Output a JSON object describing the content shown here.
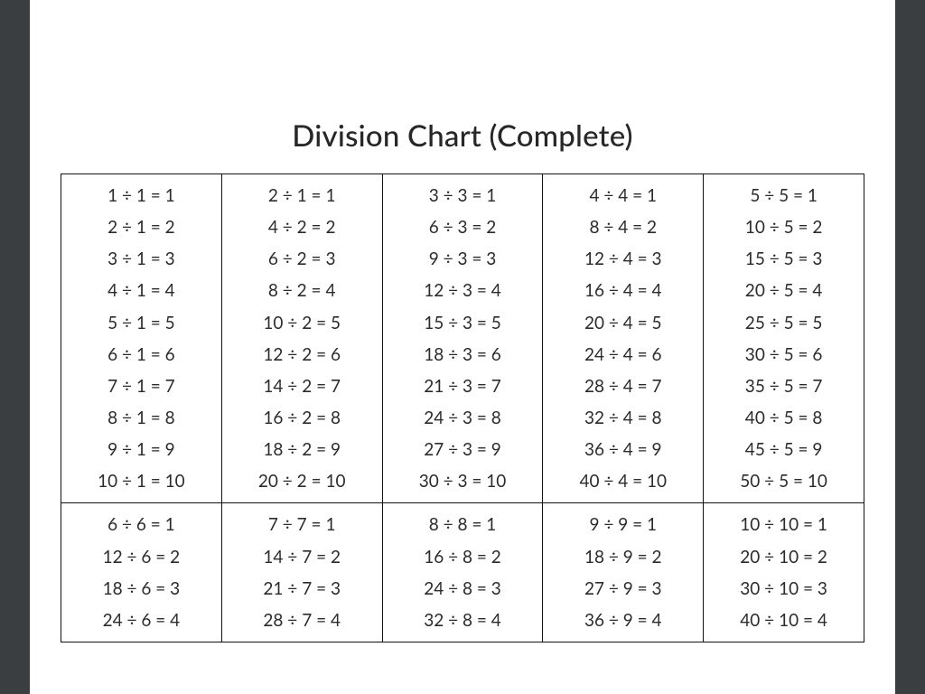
{
  "title": "Division Chart (Complete)",
  "chart_data": {
    "type": "table",
    "title": "Division Chart (Complete)",
    "divisors_row1": [
      1,
      2,
      3,
      4,
      5
    ],
    "divisors_row2": [
      6,
      7,
      8,
      9,
      10
    ],
    "quotients_row1": [
      1,
      2,
      3,
      4,
      5,
      6,
      7,
      8,
      9,
      10
    ],
    "quotients_row2_visible": [
      1,
      2,
      3,
      4
    ],
    "cells": {
      "r0c0": [
        "1 ÷ 1 = 1",
        "2 ÷ 1 = 2",
        "3 ÷ 1 = 3",
        "4 ÷ 1 = 4",
        "5 ÷ 1 = 5",
        "6 ÷ 1 = 6",
        "7 ÷ 1 = 7",
        "8 ÷ 1 = 8",
        "9 ÷ 1 = 9",
        "10 ÷ 1 = 10"
      ],
      "r0c1": [
        "2 ÷ 1 = 1",
        "4 ÷ 2 = 2",
        "6 ÷ 2 = 3",
        "8 ÷ 2 = 4",
        "10 ÷ 2 = 5",
        "12 ÷ 2 = 6",
        "14 ÷ 2 = 7",
        "16 ÷ 2 = 8",
        "18 ÷ 2 = 9",
        "20 ÷ 2 = 10"
      ],
      "r0c2": [
        "3 ÷ 3 = 1",
        "6 ÷ 3 = 2",
        "9 ÷ 3 = 3",
        "12 ÷ 3 = 4",
        "15 ÷ 3 = 5",
        "18 ÷ 3 = 6",
        "21 ÷ 3 = 7",
        "24 ÷ 3 = 8",
        "27 ÷ 3 = 9",
        "30 ÷ 3 = 10"
      ],
      "r0c3": [
        "4 ÷ 4 = 1",
        "8 ÷ 4 = 2",
        "12 ÷ 4 = 3",
        "16 ÷ 4 = 4",
        "20 ÷ 4 = 5",
        "24 ÷ 4 = 6",
        "28 ÷ 4 = 7",
        "32 ÷ 4 = 8",
        "36 ÷ 4 = 9",
        "40 ÷ 4 = 10"
      ],
      "r0c4": [
        "5 ÷ 5 = 1",
        "10 ÷ 5 = 2",
        "15 ÷ 5 = 3",
        "20 ÷ 5 = 4",
        "25 ÷ 5 = 5",
        "30 ÷ 5 = 6",
        "35 ÷ 5 = 7",
        "40 ÷ 5 = 8",
        "45 ÷ 5 = 9",
        "50 ÷ 5 = 10"
      ],
      "r1c0": [
        "6 ÷ 6 = 1",
        "12 ÷ 6 = 2",
        "18 ÷ 6 = 3",
        "24 ÷ 6 = 4"
      ],
      "r1c1": [
        "7 ÷ 7 = 1",
        "14 ÷ 7 = 2",
        "21 ÷ 7 = 3",
        "28 ÷ 7 = 4"
      ],
      "r1c2": [
        "8 ÷ 8 = 1",
        "16 ÷ 8 = 2",
        "24 ÷ 8 = 3",
        "32 ÷ 8 = 4"
      ],
      "r1c3": [
        "9 ÷ 9 = 1",
        "18 ÷ 9 = 2",
        "27 ÷ 9 = 3",
        "36 ÷ 9 = 4"
      ],
      "r1c4": [
        "10 ÷ 10 = 1",
        "20 ÷ 10 = 2",
        "30 ÷ 10 = 3",
        "40 ÷ 10 = 4"
      ]
    }
  }
}
